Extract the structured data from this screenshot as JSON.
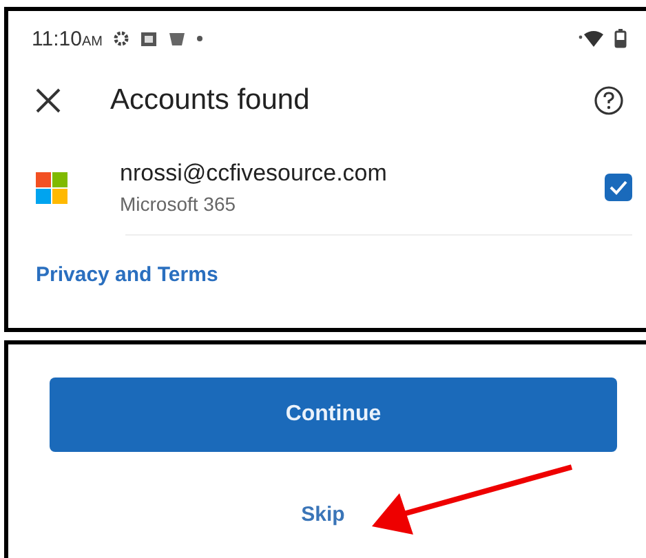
{
  "status_bar": {
    "time": "11:10",
    "meridiem": "AM"
  },
  "header": {
    "title": "Accounts found"
  },
  "accounts": [
    {
      "email": "nrossi@ccfivesource.com",
      "service": "Microsoft 365",
      "checked": true
    }
  ],
  "privacy_link": "Privacy and Terms",
  "buttons": [
    {
      "kind": "primary",
      "label": "Continue"
    },
    {
      "kind": "link",
      "label": "Skip"
    }
  ]
}
